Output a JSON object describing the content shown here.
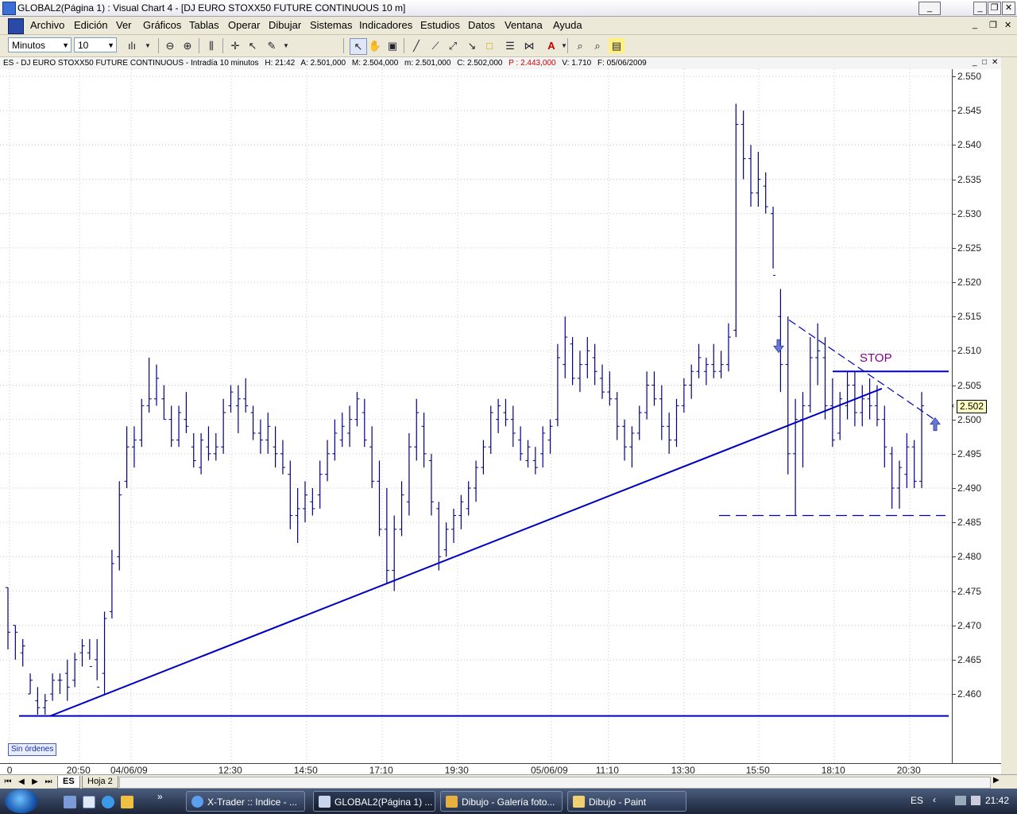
{
  "window": {
    "title": "GLOBAL2(Página 1) : Visual Chart 4 - [DJ EURO STOXX50 FUTURE CONTINUOUS 10 m]",
    "minimize": "_",
    "restore": "❐",
    "close": "✕",
    "mdi_minimize": "_",
    "mdi_restore": "❐",
    "mdi_close": "✕"
  },
  "menu": [
    "Archivo",
    "Edición",
    "Ver",
    "Gráficos",
    "Tablas",
    "Operar",
    "Dibujar",
    "Sistemas",
    "Indicadores",
    "Estudios",
    "Datos",
    "Ventana",
    "Ayuda"
  ],
  "toolbar": {
    "period_unit": "Minutos",
    "period_value": "10"
  },
  "infobar": {
    "symbol": "ES - DJ EURO STOXX50 FUTURE CONTINUOUS - Intradía 10 minutos",
    "h": "H: 21:42",
    "a": "A: 2.501,000",
    "m": "M: 2.504,000",
    "mm": "m: 2.501,000",
    "c": "C: 2.502,000",
    "p": "P : 2.443,000",
    "v": "V: 1.710",
    "f": "F: 05/06/2009",
    "p_color": "#d00000",
    "text_color": "#000080"
  },
  "chart_data": {
    "type": "bar",
    "ylim": [
      2.455,
      2.551
    ],
    "y_ticks": [
      "2.550",
      "2.545",
      "2.540",
      "2.535",
      "2.530",
      "2.525",
      "2.520",
      "2.515",
      "2.510",
      "2.505",
      "2.500",
      "2.495",
      "2.490",
      "2.485",
      "2.480",
      "2.475",
      "2.470",
      "2.465",
      "2.460"
    ],
    "x_ticks": [
      "0",
      "20:50",
      "04/06/09",
      "12:30",
      "14:50",
      "17:10",
      "19:30",
      "05/06/09",
      "11:10",
      "13:30",
      "15:50",
      "18:10",
      "20:30"
    ],
    "last_price": "2.502",
    "stop_label": "STOP",
    "bar_color": "#000080",
    "line_color": "#0000c0",
    "annotation_color": "#800080",
    "ohlc": [
      [
        2.4755,
        2.4665,
        2.4755,
        2.469
      ],
      [
        2.47,
        2.465,
        2.47,
        2.469
      ],
      [
        2.468,
        2.464,
        2.466,
        2.467
      ],
      [
        2.463,
        2.46,
        2.46,
        2.462
      ],
      [
        2.461,
        2.457,
        2.459,
        2.458
      ],
      [
        2.46,
        2.457,
        2.458,
        2.459
      ],
      [
        2.463,
        2.459,
        2.46,
        2.462
      ],
      [
        2.463,
        2.46,
        2.462,
        2.462
      ],
      [
        2.465,
        2.459,
        2.463,
        2.461
      ],
      [
        2.466,
        2.461,
        2.462,
        2.465
      ],
      [
        2.468,
        2.464,
        2.466,
        2.467
      ],
      [
        2.468,
        2.465,
        2.466,
        2.464
      ],
      [
        2.468,
        2.462,
        2.465,
        2.461
      ],
      [
        2.472,
        2.46,
        2.463,
        2.471
      ],
      [
        2.481,
        2.471,
        2.472,
        2.479
      ],
      [
        2.491,
        2.478,
        2.48,
        2.489
      ],
      [
        2.499,
        2.49,
        2.491,
        2.496
      ],
      [
        2.499,
        2.493,
        2.496,
        2.497
      ],
      [
        2.503,
        2.496,
        2.497,
        2.502
      ],
      [
        2.509,
        2.501,
        2.502,
        2.503
      ],
      [
        2.508,
        2.502,
        2.503,
        2.506
      ],
      [
        2.505,
        2.5,
        2.503,
        2.5
      ],
      [
        2.502,
        2.496,
        2.5,
        2.497
      ],
      [
        2.502,
        2.496,
        2.497,
        2.501
      ],
      [
        2.504,
        2.498,
        2.5,
        2.499
      ],
      [
        2.498,
        2.493,
        2.496,
        2.494
      ],
      [
        2.498,
        2.492,
        2.493,
        2.497
      ],
      [
        2.499,
        2.494,
        2.496,
        2.495
      ],
      [
        2.498,
        2.494,
        2.495,
        2.496
      ],
      [
        2.503,
        2.495,
        2.496,
        2.501
      ],
      [
        2.505,
        2.501,
        2.502,
        2.504
      ],
      [
        2.505,
        2.498,
        2.502,
        2.503
      ],
      [
        2.506,
        2.501,
        2.503,
        2.502
      ],
      [
        2.502,
        2.497,
        2.501,
        2.498
      ],
      [
        2.5,
        2.495,
        2.498,
        2.497
      ],
      [
        2.501,
        2.495,
        2.497,
        2.499
      ],
      [
        2.499,
        2.493,
        2.496,
        2.495
      ],
      [
        2.497,
        2.492,
        2.495,
        2.493
      ],
      [
        2.494,
        2.484,
        2.492,
        2.486
      ],
      [
        2.49,
        2.482,
        2.486,
        2.487
      ],
      [
        2.491,
        2.485,
        2.487,
        2.489
      ],
      [
        2.49,
        2.486,
        2.488,
        2.487
      ],
      [
        2.494,
        2.487,
        2.489,
        2.492
      ],
      [
        2.497,
        2.491,
        2.492,
        2.495
      ],
      [
        2.5,
        2.494,
        2.495,
        2.498
      ],
      [
        2.501,
        2.496,
        2.497,
        2.499
      ],
      [
        2.502,
        2.496,
        2.498,
        2.5
      ],
      [
        2.504,
        2.499,
        2.5,
        2.503
      ],
      [
        2.503,
        2.496,
        2.501,
        2.497
      ],
      [
        2.499,
        2.49,
        2.496,
        2.491
      ],
      [
        2.494,
        2.483,
        2.491,
        2.484
      ],
      [
        2.49,
        2.476,
        2.484,
        2.478
      ],
      [
        2.486,
        2.475,
        2.478,
        2.484
      ],
      [
        2.491,
        2.483,
        2.484,
        2.489
      ],
      [
        2.498,
        2.486,
        2.488,
        2.496
      ],
      [
        2.503,
        2.494,
        2.496,
        2.501
      ],
      [
        2.501,
        2.493,
        2.499,
        2.495
      ],
      [
        2.495,
        2.486,
        2.494,
        2.488
      ],
      [
        2.488,
        2.478,
        2.487,
        2.48
      ],
      [
        2.485,
        2.48,
        2.481,
        2.484
      ],
      [
        2.487,
        2.482,
        2.484,
        2.486
      ],
      [
        2.489,
        2.484,
        2.486,
        2.488
      ],
      [
        2.491,
        2.486,
        2.487,
        2.49
      ],
      [
        2.494,
        2.488,
        2.49,
        2.493
      ],
      [
        2.497,
        2.492,
        2.493,
        2.496
      ],
      [
        2.502,
        2.495,
        2.496,
        2.501
      ],
      [
        2.503,
        2.498,
        2.5,
        2.502
      ],
      [
        2.503,
        2.499,
        2.501,
        2.5
      ],
      [
        2.502,
        2.496,
        2.5,
        2.498
      ],
      [
        2.499,
        2.494,
        2.497,
        2.495
      ],
      [
        2.497,
        2.493,
        2.494,
        2.496
      ],
      [
        2.496,
        2.492,
        2.494,
        2.493
      ],
      [
        2.499,
        2.493,
        2.495,
        2.498
      ],
      [
        2.5,
        2.495,
        2.497,
        2.499
      ],
      [
        2.511,
        2.499,
        2.5,
        2.509
      ],
      [
        2.515,
        2.506,
        2.508,
        2.512
      ],
      [
        2.512,
        2.505,
        2.511,
        2.506
      ],
      [
        2.51,
        2.504,
        2.506,
        2.508
      ],
      [
        2.512,
        2.506,
        2.508,
        2.51
      ],
      [
        2.511,
        2.505,
        2.509,
        2.507
      ],
      [
        2.508,
        2.503,
        2.506,
        2.504
      ],
      [
        2.507,
        2.502,
        2.504,
        2.503
      ],
      [
        2.504,
        2.497,
        2.503,
        2.499
      ],
      [
        2.5,
        2.494,
        2.499,
        2.496
      ],
      [
        2.499,
        2.493,
        2.496,
        2.498
      ],
      [
        2.502,
        2.497,
        2.498,
        2.501
      ],
      [
        2.507,
        2.5,
        2.501,
        2.505
      ],
      [
        2.507,
        2.502,
        2.505,
        2.503
      ],
      [
        2.505,
        2.497,
        2.503,
        2.499
      ],
      [
        2.501,
        2.495,
        2.499,
        2.497
      ],
      [
        2.503,
        2.496,
        2.497,
        2.502
      ],
      [
        2.506,
        2.501,
        2.502,
        2.505
      ],
      [
        2.508,
        2.503,
        2.505,
        2.507
      ],
      [
        2.511,
        2.506,
        2.507,
        2.509
      ],
      [
        2.509,
        2.505,
        2.507,
        2.508
      ],
      [
        2.511,
        2.506,
        2.508,
        2.507
      ],
      [
        2.51,
        2.506,
        2.507,
        2.508
      ],
      [
        2.514,
        2.507,
        2.508,
        2.512
      ],
      [
        2.546,
        2.512,
        2.513,
        2.543
      ],
      [
        2.545,
        2.535,
        2.543,
        2.538
      ],
      [
        2.54,
        2.531,
        2.538,
        2.533
      ],
      [
        2.539,
        2.531,
        2.533,
        2.535
      ],
      [
        2.536,
        2.53,
        2.534,
        2.531
      ],
      [
        2.531,
        2.522,
        2.53,
        2.521
      ],
      [
        2.519,
        2.504,
        2.515,
        2.508
      ],
      [
        2.515,
        2.492,
        2.508,
        2.495
      ],
      [
        2.503,
        2.486,
        2.495,
        2.5
      ],
      [
        2.504,
        2.493,
        2.5,
        2.502
      ],
      [
        2.512,
        2.501,
        2.502,
        2.509
      ],
      [
        2.514,
        2.505,
        2.509,
        2.51
      ],
      [
        2.512,
        2.5,
        2.509,
        2.502
      ],
      [
        2.506,
        2.496,
        2.502,
        2.497
      ],
      [
        2.504,
        2.497,
        2.498,
        2.503
      ],
      [
        2.507,
        2.5,
        2.502,
        2.505
      ],
      [
        2.507,
        2.499,
        2.505,
        2.501
      ],
      [
        2.505,
        2.499,
        2.501,
        2.503
      ],
      [
        2.506,
        2.5,
        2.503,
        2.502
      ],
      [
        2.505,
        2.499,
        2.502,
        2.5
      ],
      [
        2.502,
        2.493,
        2.5,
        2.496
      ],
      [
        2.496,
        2.487,
        2.495,
        2.49
      ],
      [
        2.494,
        2.487,
        2.49,
        2.493
      ],
      [
        2.498,
        2.49,
        2.492,
        2.496
      ],
      [
        2.497,
        2.49,
        2.496,
        2.491
      ],
      [
        2.504,
        2.49,
        2.491,
        2.502
      ]
    ],
    "drawings": {
      "uptrend_line": {
        "from_bar": 4,
        "from_price": 2.4568,
        "to_bar": 117,
        "to_price": 2.5045
      },
      "support_line": {
        "from_bar": 1,
        "to_bar": 128,
        "price": 2.4568
      },
      "dashed_low_line": {
        "from_bar": 100,
        "to_bar": 127,
        "price": 2.486
      },
      "stop_line": {
        "from_bar": 114,
        "to_bar": 128,
        "price": 2.507
      },
      "downtrend_dashed": {
        "from_bar": 108,
        "from_price": 2.5145,
        "to_bar": 126,
        "to_price": 2.5
      },
      "down_arrow": {
        "bar": 105,
        "price": 2.51
      },
      "up_arrow": {
        "bar": 126,
        "price": 2.5
      }
    }
  },
  "bottom": {
    "orders_status": "Sin órdenes",
    "tabs": [
      "ES",
      "Hoja 2"
    ],
    "nav": [
      "⏮",
      "◀",
      "▶",
      "⏭"
    ]
  },
  "taskbar": {
    "tasks": [
      "X-Trader :: Indice - ...",
      "GLOBAL2(Página 1) ...",
      "Dibujo - Galería foto...",
      "Dibujo - Paint"
    ],
    "language": "ES",
    "clock": "21:42",
    "quick_more": "»"
  }
}
